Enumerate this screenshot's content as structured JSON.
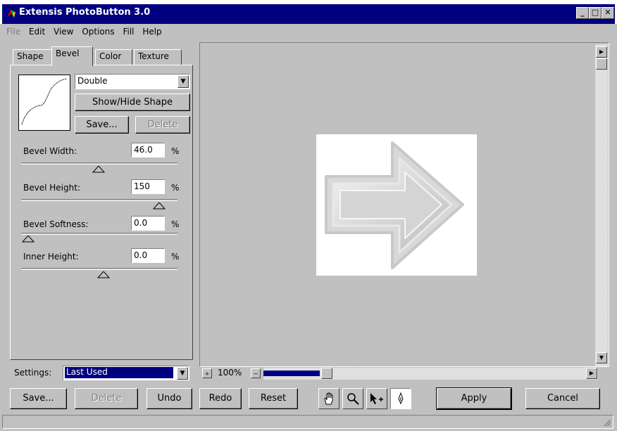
{
  "window": {
    "title": "Extensis PhotoButton 3.0"
  },
  "menu": {
    "items": [
      "File",
      "Edit",
      "View",
      "Options",
      "Fill",
      "Help"
    ]
  },
  "tabs": [
    "Shape",
    "Bevel",
    "Color",
    "Texture"
  ],
  "active_tab": "Bevel",
  "bevel": {
    "style_value": "Double",
    "show_hide_label": "Show/Hide Shape",
    "save_label": "Save...",
    "delete_label": "Delete",
    "fields": [
      {
        "label": "Bevel Width:",
        "value": "46.0",
        "unit": "%",
        "slider": 0.5
      },
      {
        "label": "Bevel Height:",
        "value": "150",
        "unit": "%",
        "slider": 0.85
      },
      {
        "label": "Bevel Softness:",
        "value": "0.0",
        "unit": "%",
        "slider": 0.0
      },
      {
        "label": "Inner Height:",
        "value": "0.0",
        "unit": "%",
        "slider": 0.5
      }
    ]
  },
  "settings": {
    "label": "Settings:",
    "value": "Last Used"
  },
  "zoom": {
    "value": "100%"
  },
  "buttons": {
    "save": "Save...",
    "delete": "Delete",
    "undo": "Undo",
    "redo": "Redo",
    "reset": "Reset",
    "apply": "Apply",
    "cancel": "Cancel"
  },
  "tools": [
    "hand-icon",
    "magnifier-icon",
    "move-arrow-icon",
    "pen-icon"
  ],
  "colors": {
    "titlebar": "#000080",
    "face": "#c0c0c0",
    "selection": "#000080"
  }
}
